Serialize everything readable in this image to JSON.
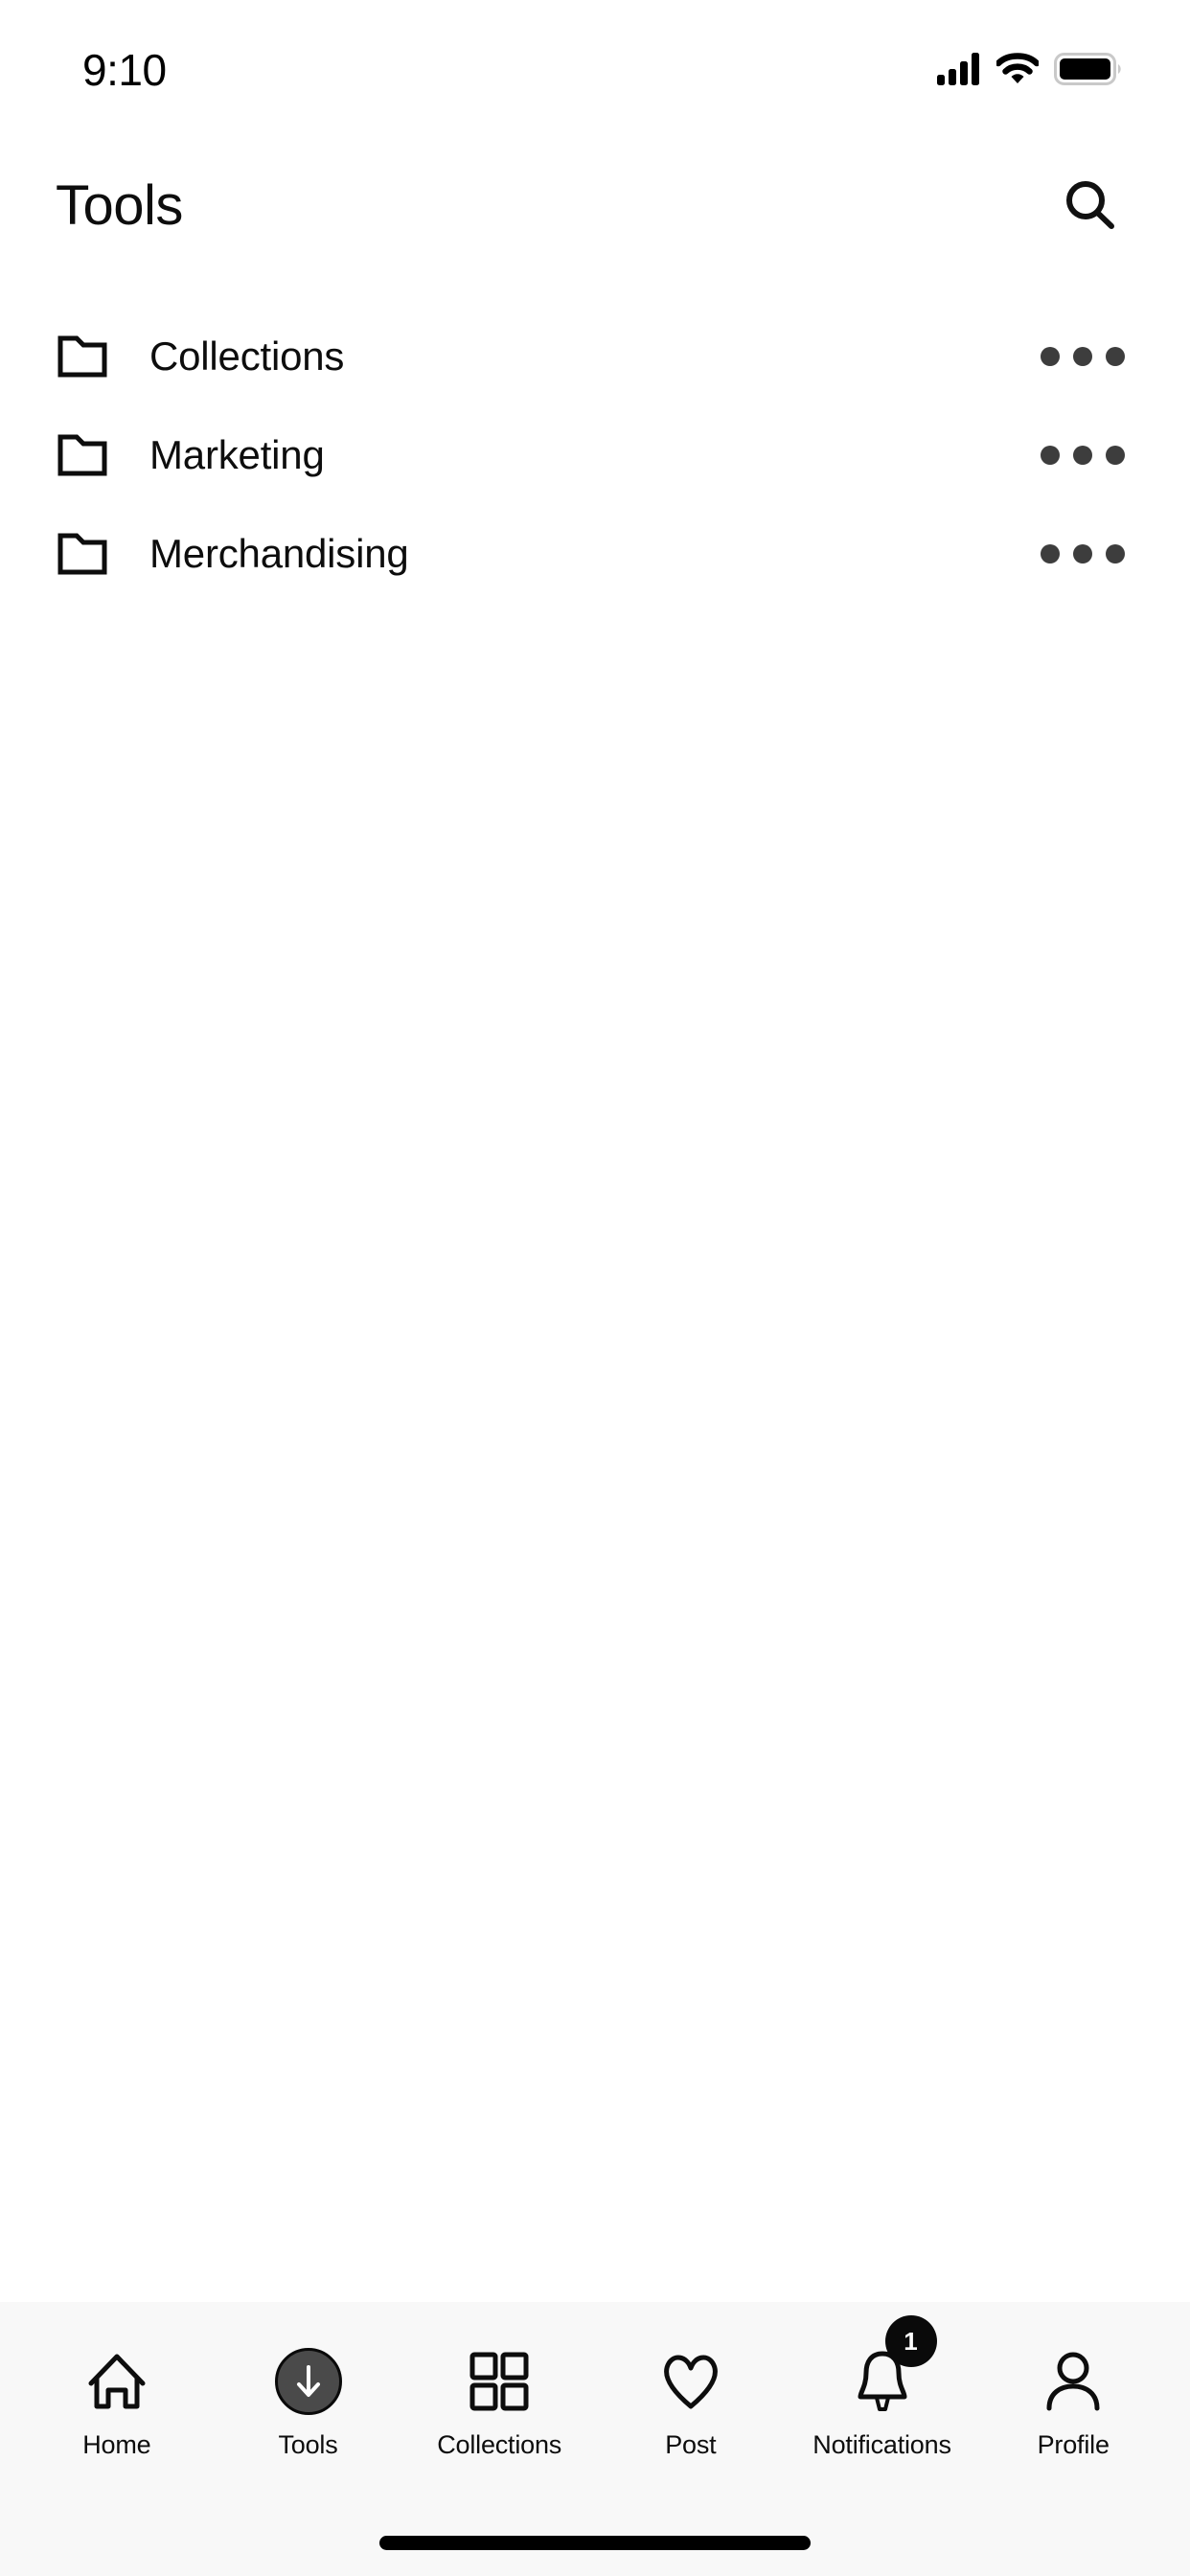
{
  "status_bar": {
    "time": "9:10",
    "icons": [
      "cellular-signal-icon",
      "wifi-icon",
      "battery-icon"
    ],
    "battery_level": "full"
  },
  "header": {
    "title": "Tools",
    "search_icon": "search-icon"
  },
  "folders": {
    "row_icon": "folder-icon",
    "more_icon": "more-horizontal-icon",
    "items": [
      {
        "label": "Collections"
      },
      {
        "label": "Marketing"
      },
      {
        "label": "Merchandising"
      }
    ]
  },
  "bottom_nav": {
    "active_index": 1,
    "items": [
      {
        "label": "Home",
        "icon": "home-icon",
        "badge": ""
      },
      {
        "label": "Tools",
        "icon": "arrow-down-circle-icon",
        "badge": ""
      },
      {
        "label": "Collections",
        "icon": "grid-icon",
        "badge": ""
      },
      {
        "label": "Post",
        "icon": "heart-icon",
        "badge": ""
      },
      {
        "label": "Notifications",
        "icon": "bell-icon",
        "badge": "1"
      },
      {
        "label": "Profile",
        "icon": "person-icon",
        "badge": ""
      }
    ]
  },
  "colors": {
    "background": "#ffffff",
    "nav_background": "#f8f8f8",
    "text": "#0d0d0d",
    "muted": "#3d3d3d",
    "accent": "#0a0a0a"
  }
}
